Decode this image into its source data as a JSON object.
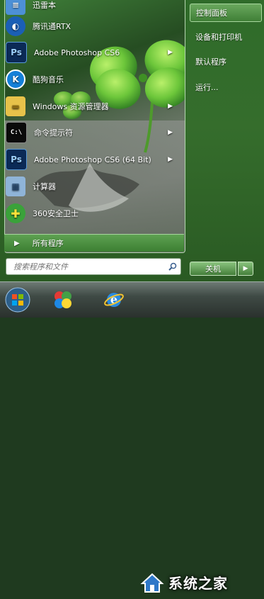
{
  "programs": [
    {
      "label": "迅雷本",
      "icon": "xunlei-icon",
      "color": "#4d90d6",
      "glyph": "≡",
      "arrow": false
    },
    {
      "label": "腾讯通RTX",
      "icon": "rtx-icon",
      "color": "#1b5fb5",
      "glyph": "◐",
      "arrow": false
    },
    {
      "label": "Adobe Photoshop CS6",
      "icon": "photoshop-icon",
      "color": "#0b2a56",
      "glyph": "Ps",
      "arrow": true
    },
    {
      "label": "酷狗音乐",
      "icon": "kugou-icon",
      "color": "#1580d8",
      "glyph": "K",
      "arrow": false
    },
    {
      "label": "Windows 资源管理器",
      "icon": "folder-icon",
      "color": "#e7c24a",
      "glyph": "▬",
      "arrow": true
    },
    {
      "label": "命令提示符",
      "icon": "cmd-icon",
      "color": "#0a0a0a",
      "glyph": "C:\\",
      "arrow": true
    },
    {
      "label": "Adobe Photoshop CS6 (64 Bit)",
      "icon": "photoshop-icon",
      "color": "#0b2a56",
      "glyph": "Ps",
      "arrow": true
    },
    {
      "label": "计算器",
      "icon": "calculator-icon",
      "color": "#8fb4d8",
      "glyph": "▦",
      "arrow": false
    },
    {
      "label": "360安全卫士",
      "icon": "360-safe-icon",
      "color": "#3aa23a",
      "glyph": "✚",
      "arrow": false
    }
  ],
  "all_programs": "所有程序",
  "right_menu": [
    {
      "label": "控制面板",
      "highlight": true
    },
    {
      "label": "设备和打印机",
      "highlight": false
    },
    {
      "label": "默认程序",
      "highlight": false
    },
    {
      "label": "运行...",
      "highlight": false
    }
  ],
  "search": {
    "placeholder": "搜索程序和文件"
  },
  "shutdown": {
    "label": "关机"
  },
  "taskbar": {
    "items": [
      "start-orb-icon",
      "360-browser-icon",
      "ie-icon"
    ],
    "watermark": "系统之家"
  }
}
